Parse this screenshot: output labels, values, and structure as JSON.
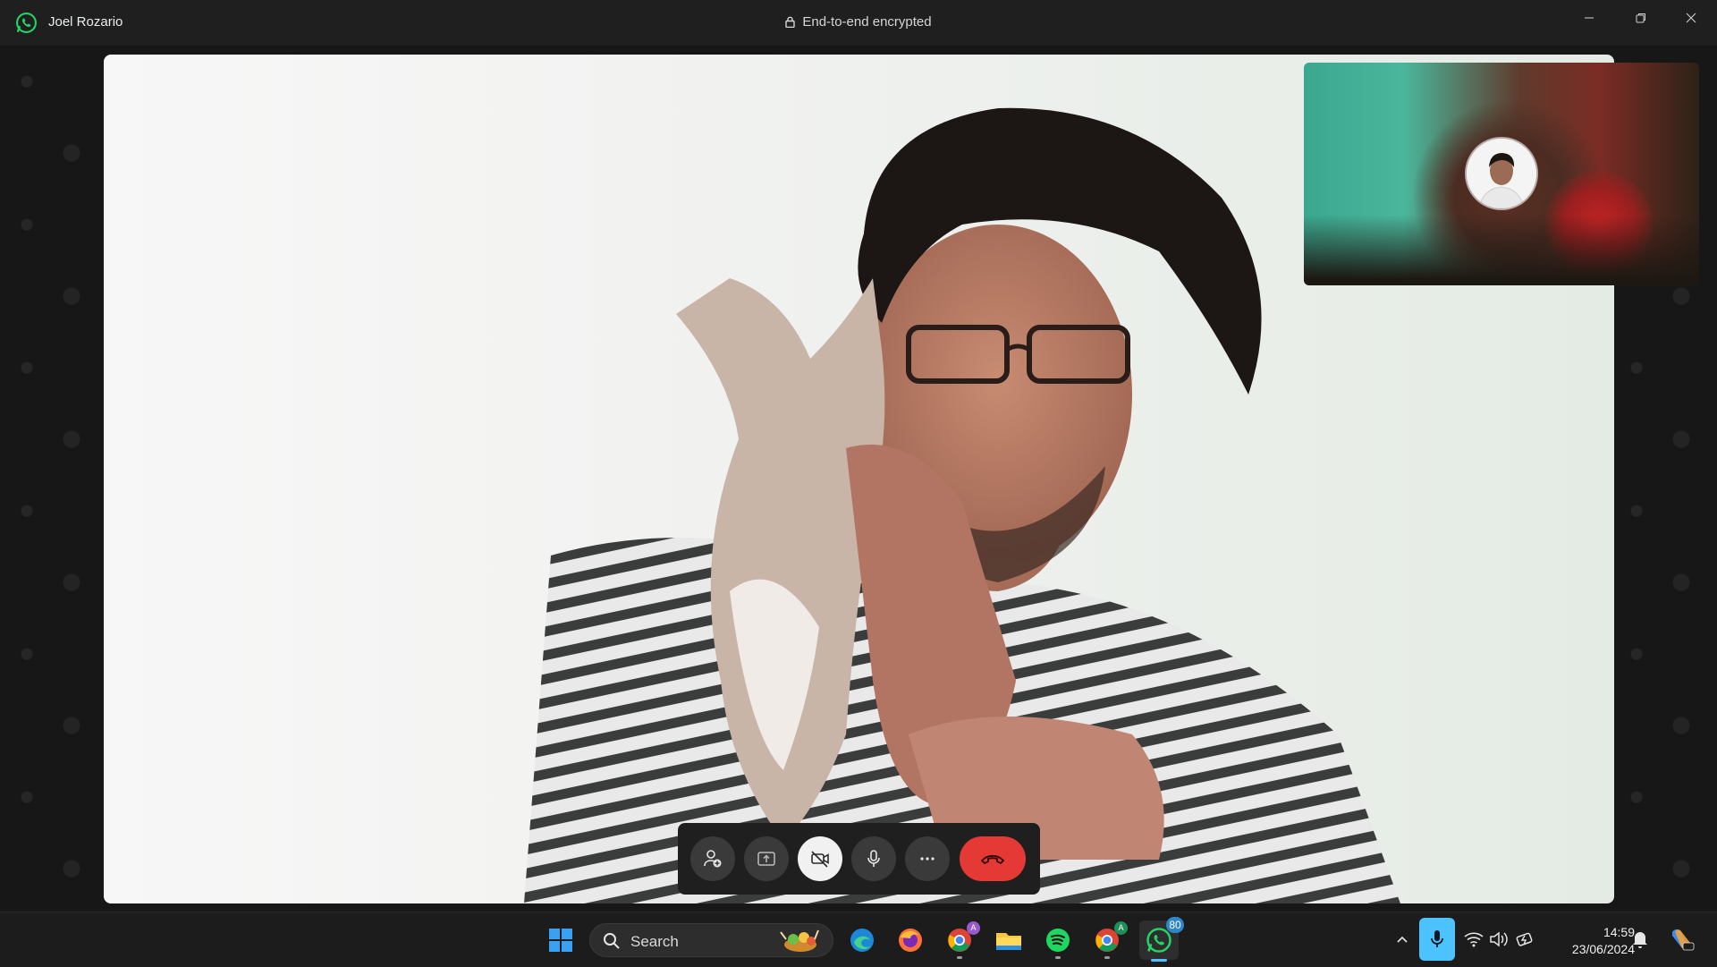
{
  "window": {
    "title": "Joel Rozario",
    "encryption_label": "End-to-end encrypted",
    "icons": [
      "whatsapp-logo-icon",
      "lock-icon",
      "minimize-icon",
      "restore-icon",
      "close-icon"
    ]
  },
  "call": {
    "controls": [
      {
        "name": "add-participant-button",
        "icon": "add-person-icon"
      },
      {
        "name": "share-screen-button",
        "icon": "share-screen-icon"
      },
      {
        "name": "camera-off-button",
        "icon": "video-off-icon",
        "active": true
      },
      {
        "name": "microphone-button",
        "icon": "microphone-icon"
      },
      {
        "name": "more-options-button",
        "icon": "more-icon"
      },
      {
        "name": "end-call-button",
        "icon": "phone-hangup-icon",
        "color": "#e53935"
      }
    ]
  },
  "taskbar": {
    "search_label": "Search",
    "apps": [
      "windows-start-icon",
      "edge-icon",
      "firefox-icon",
      "chrome-profile-a-icon",
      "file-explorer-icon",
      "spotify-icon",
      "chrome-profile-b-icon",
      "whatsapp-icon"
    ],
    "chrome_profile_a_badge": "A",
    "chrome_profile_b_badge": "A",
    "whatsapp_badge": "80",
    "tray_icons": [
      "chevron-up-icon",
      "microphone-active-icon",
      "wifi-icon",
      "volume-icon",
      "battery-charging-icon"
    ],
    "time": "14:59",
    "date": "23/06/2024",
    "accent": "#4cc2ff"
  },
  "colors": {
    "whatsapp_green": "#25d366",
    "end_call_red": "#e53935",
    "titlebar_bg": "#1f1f1f"
  }
}
